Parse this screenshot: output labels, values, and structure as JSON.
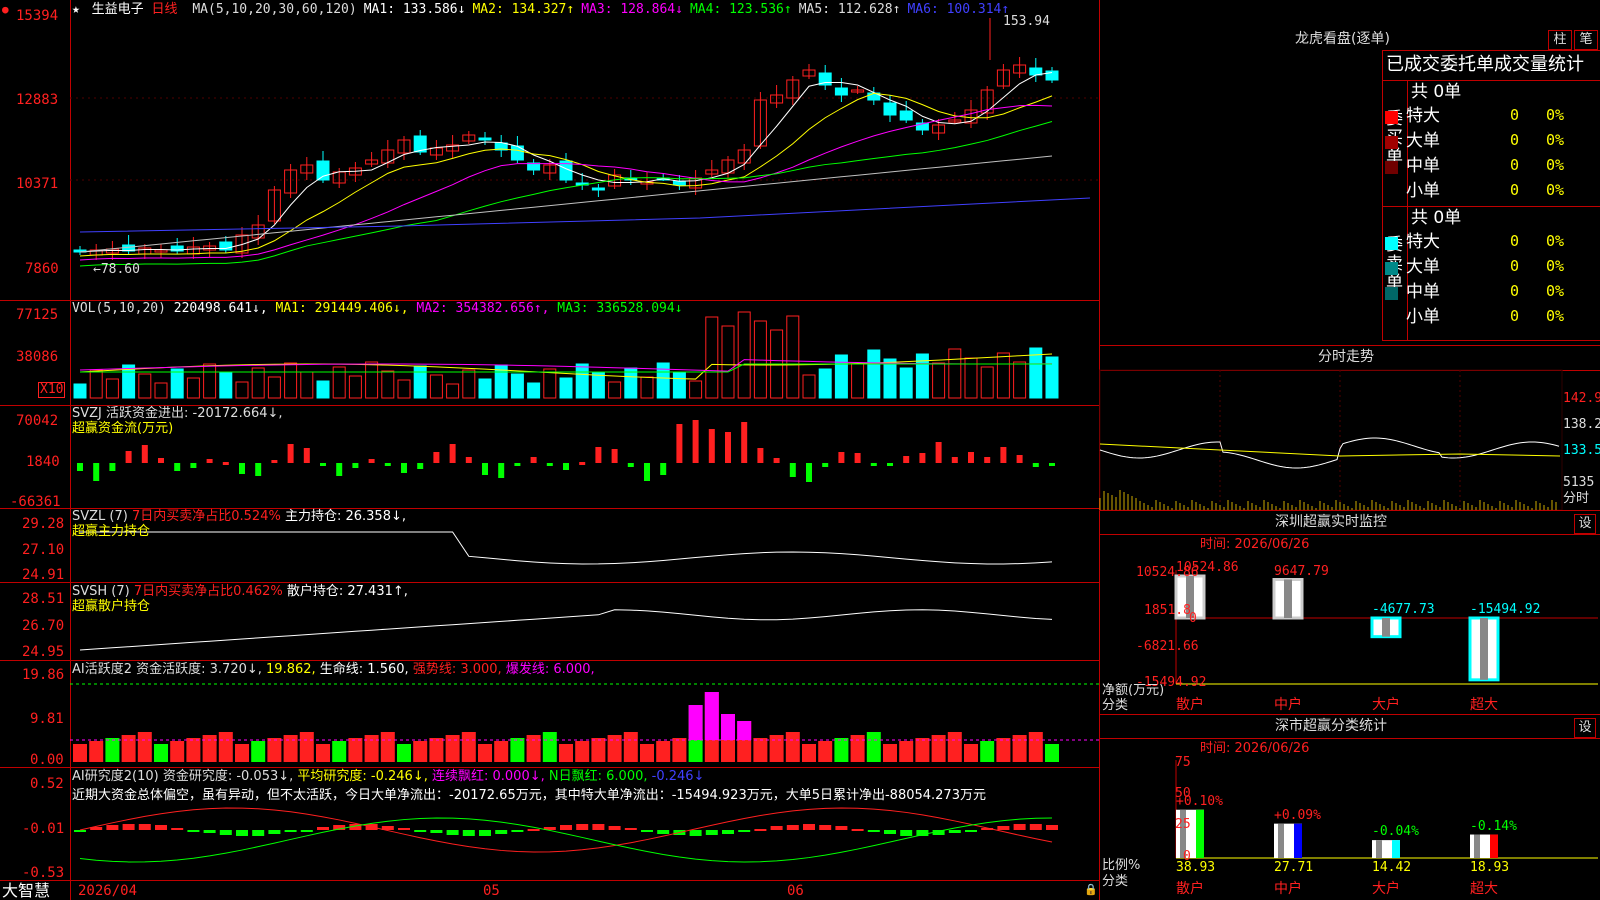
{
  "colors": {
    "up": "#ff2020",
    "down": "#00ffff",
    "green": "#00ff00",
    "yellow": "#ffff00",
    "magenta": "#ff00ff",
    "white": "#ffffff",
    "grid": "#c00000",
    "blue": "#4040ff",
    "gray": "#c0c0c0"
  },
  "title": {
    "star": "★",
    "stock": "生益电子",
    "period": "日线"
  },
  "ma_line": [
    {
      "name": "MA(5,10,20,30,60,120)",
      "value": "",
      "color": "#dddddd"
    },
    {
      "name": "MA1:",
      "value": "133.586",
      "arrow": "↓",
      "color": "#ffffff"
    },
    {
      "name": "MA2:",
      "value": "134.327",
      "arrow": "↑",
      "color": "#ffff00"
    },
    {
      "name": "MA3:",
      "value": "128.864",
      "arrow": "↓",
      "color": "#ff00ff"
    },
    {
      "name": "MA4:",
      "value": "123.536",
      "arrow": "↑",
      "color": "#00ff00"
    },
    {
      "name": "MA5:",
      "value": "112.628",
      "arrow": "↑",
      "color": "#dddddd"
    },
    {
      "name": "MA6:",
      "value": "100.314",
      "arrow": "↑",
      "color": "#4040ff"
    }
  ],
  "price_panel": {
    "y_labels": [
      "15394",
      "12883",
      "10371",
      "7860"
    ],
    "high_mark": "153.94",
    "low_mark": "←78.60"
  },
  "vol_panel": {
    "header": [
      "VOL(5,10,20)",
      "220498.641↓,",
      "MA1: 291449.406↓,",
      "MA2: 354382.656↑,",
      "MA3: 336528.094↓"
    ],
    "y_labels": [
      "77125",
      "38086"
    ],
    "unit": "X10"
  },
  "svzj_panel": {
    "header": "SVZJ  活跃资金进出: -20172.664↓,",
    "sub": "超赢资金流(万元)",
    "y_labels": [
      "70042",
      "1840",
      "-66361"
    ]
  },
  "svzl_panel": {
    "h1": "SVZL (7)",
    "h2": "7日内买卖净占比0.524%",
    "h3": "主力持仓: 26.358↓,",
    "sub": "超赢主力持仓",
    "y_labels": [
      "29.28",
      "27.10",
      "24.91"
    ]
  },
  "svsh_panel": {
    "h1": "SVSH (7)",
    "h2": "7日内买卖净占比0.462%",
    "h3": "散户持仓: 27.431↑,",
    "sub": "超赢散户持仓",
    "y_labels": [
      "28.51",
      "26.70",
      "24.95"
    ]
  },
  "ai2_panel": {
    "h1": "AI活跃度2 资金活跃度: 3.720↓,",
    "h2": "19.862,",
    "h3": "生命线: 1.560,",
    "h4": "强势线: 3.000,",
    "h5": "爆发线: 6.000,",
    "y_labels": [
      "19.86",
      "9.81",
      "0.00"
    ]
  },
  "ai_research": {
    "h1": "AI研究度2(10) 资金研究度: -0.053↓,",
    "h2": "平均研究度: -0.246↓,",
    "h3": "连续飘红: 0.000↓,",
    "h4": "N日飘红: 6.000,",
    "h5": "-0.246↓",
    "desc": "近期大资金总体偏空，虽有异动，但不太活跃，今日大单净流出：-20172.65万元，其中特大单净流出：-15494.923万元，大单5日累计净出-88054.273万元",
    "y_labels": [
      "0.52",
      "-0.01",
      "-0.53"
    ]
  },
  "bottom_bar": {
    "brand": "大智慧",
    "date_start": "2026/04",
    "m1": "05",
    "m2": "06"
  },
  "dragon": {
    "title": "龙虎看盘(逐单)",
    "btn1": "柱",
    "btn2": "笔",
    "header": "已成交委托单成交量统计",
    "buy": {
      "side": "委买单",
      "total": "共 0单",
      "rows": [
        {
          "name": "特大",
          "v": "0",
          "p": "0%",
          "color": "#ff0000"
        },
        {
          "name": "大单",
          "v": "0",
          "p": "0%",
          "color": "#a00000"
        },
        {
          "name": "中单",
          "v": "0",
          "p": "0%",
          "color": "#700000"
        },
        {
          "name": "小单",
          "v": "0",
          "p": "0%",
          "color": ""
        }
      ]
    },
    "sell": {
      "side": "委卖单",
      "total": "共 0单",
      "rows": [
        {
          "name": "特大",
          "v": "0",
          "p": "0%",
          "color": "#00ffff"
        },
        {
          "name": "大单",
          "v": "0",
          "p": "0%",
          "color": "#008888"
        },
        {
          "name": "中单",
          "v": "0",
          "p": "0%",
          "color": "#006666"
        },
        {
          "name": "小单",
          "v": "0",
          "p": "0%",
          "color": ""
        }
      ]
    }
  },
  "intraday": {
    "title": "分时走势",
    "y_labels": [
      "142.9",
      "138.2",
      "133.5",
      "5135"
    ],
    "unit": "分时"
  },
  "monitor": {
    "title": "深圳超赢实时监控",
    "btn": "设",
    "time": "时间: 2026/06/26",
    "y_labels": [
      "10524.86",
      "1851.8",
      "0",
      "-6821.66",
      "-15494.92"
    ],
    "axis_title": "净额(万元)",
    "axis_sub": "分类",
    "cats": [
      "散户",
      "中户",
      "大户",
      "超大"
    ],
    "values": [
      "10524.86",
      "9647.79",
      "-4677.73",
      "-15494.92"
    ]
  },
  "stats": {
    "title": "深市超赢分类统计",
    "btn": "设",
    "time": "时间: 2026/06/26",
    "y_labels": [
      "75",
      "50",
      "25",
      "0"
    ],
    "axis_title": "比例%",
    "axis_sub": "分类",
    "cats": [
      "散户",
      "中户",
      "大户",
      "超大"
    ],
    "changes": [
      "+0.10%",
      "+0.09%",
      "-0.04%",
      "-0.14%"
    ],
    "values": [
      "38.93",
      "27.71",
      "14.42",
      "18.93"
    ]
  }
}
